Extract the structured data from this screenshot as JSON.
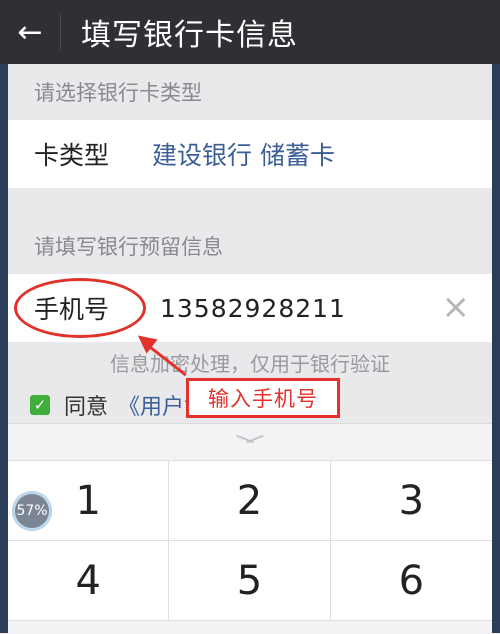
{
  "header": {
    "back_icon": "back-arrow-icon",
    "back_glyph": "←",
    "title": "填写银行卡信息"
  },
  "card_type_section": {
    "label": "请选择银行卡类型",
    "row_label": "卡类型",
    "row_value": "建设银行 储蓄卡"
  },
  "reserved_info_section": {
    "label": "请填写银行预留信息",
    "phone_label": "手机号",
    "phone_value": "13582928211",
    "clear_glyph": "×",
    "hint": "信息加密处理，仅用于银行验证"
  },
  "agreement": {
    "check_glyph": "✓",
    "text": "同意",
    "link": "《用户协议》"
  },
  "annotation": {
    "callout_text": "输入手机号",
    "color": "#e3322b"
  },
  "keyboard": {
    "keys": [
      "1",
      "2",
      "3",
      "4",
      "5",
      "6"
    ]
  },
  "overlay_badge": {
    "text": "57%"
  }
}
